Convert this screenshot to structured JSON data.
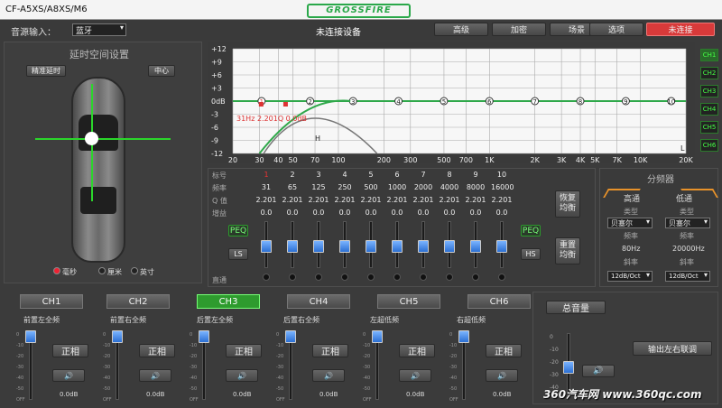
{
  "window": {
    "title": "CF-A5XS/A8XS/M6"
  },
  "toolbar": {
    "source_label": "音源输入：",
    "source_value": "蓝牙",
    "status": "未连接设备",
    "buttons": [
      "高级",
      "加密",
      "场景",
      "选项"
    ],
    "connect_label": "未连接",
    "logo": "GROSSFIRE"
  },
  "delay": {
    "title": "延时空间设置",
    "precise_label": "精准延时",
    "center_label": "中心",
    "units": [
      "毫秒",
      "厘米",
      "英寸"
    ]
  },
  "eq_graph": {
    "y_ticks": [
      "+12",
      "+9",
      "+6",
      "+3",
      "0dB",
      "-3",
      "-6",
      "-9",
      "-12"
    ],
    "x_ticks": [
      "20",
      "30",
      "40",
      "50",
      "70",
      "100",
      "200",
      "300",
      "500",
      "700",
      "1K",
      "2K",
      "3K",
      "4K",
      "5K",
      "7K",
      "10K",
      "20K"
    ],
    "band_markers": [
      "1",
      "2",
      "3",
      "4",
      "5",
      "6",
      "7",
      "8",
      "9",
      "10"
    ],
    "readout": "31Hz 2.201Q 0.0dB",
    "marker_h": "H",
    "marker_l": "L",
    "channels": [
      "CH1",
      "CH2",
      "CH3",
      "CH4",
      "CH5",
      "CH6"
    ]
  },
  "eq_table": {
    "row_labels": [
      "标号",
      "频率",
      "Q 值",
      "增益"
    ],
    "bands": [
      "1",
      "2",
      "3",
      "4",
      "5",
      "6",
      "7",
      "8",
      "9",
      "10"
    ],
    "freqs": [
      "31",
      "65",
      "125",
      "250",
      "500",
      "1000",
      "2000",
      "4000",
      "8000",
      "16000"
    ],
    "q": [
      "2.201",
      "2.201",
      "2.201",
      "2.201",
      "2.201",
      "2.201",
      "2.201",
      "2.201",
      "2.201",
      "2.201"
    ],
    "gains": [
      "0.0",
      "0.0",
      "0.0",
      "0.0",
      "0.0",
      "0.0",
      "0.0",
      "0.0",
      "0.0",
      "0.0"
    ],
    "bypass_label": "直通",
    "peq_left": "PEQ",
    "ls_label": "LS",
    "peq_right": "PEQ",
    "hs_label": "HS",
    "restore_label": "恢复均衡",
    "reset_label": "重置均衡"
  },
  "crossover": {
    "title": "分频器",
    "hp_title": "高通",
    "lp_title": "低通",
    "type_label": "类型",
    "hp_type": "贝塞尔",
    "lp_type": "贝塞尔",
    "freq_label": "频率",
    "hp_freq": "80Hz",
    "lp_freq": "20000Hz",
    "slope_label": "斜率",
    "hp_slope": "12dB/Oct",
    "lp_slope": "12dB/Oct"
  },
  "channels": [
    {
      "name": "CH1",
      "label": "前置左全频",
      "phase": "正相",
      "level": "0.0dB"
    },
    {
      "name": "CH2",
      "label": "前置右全频",
      "phase": "正相",
      "level": "0.0dB"
    },
    {
      "name": "CH3",
      "label": "后置左全频",
      "phase": "正相",
      "level": "0.0dB"
    },
    {
      "name": "CH4",
      "label": "后置右全频",
      "phase": "正相",
      "level": "0.0dB"
    },
    {
      "name": "CH5",
      "label": "左超低频",
      "phase": "正相",
      "level": "0.0dB"
    },
    {
      "name": "CH6",
      "label": "右超低频",
      "phase": "正相",
      "level": "0.0dB"
    }
  ],
  "fader_ticks": [
    "0",
    "-10",
    "-20",
    "-30",
    "-40",
    "-50",
    "OFF"
  ],
  "master": {
    "title": "总音量",
    "link_label": "输出左右联调",
    "ticks": [
      "0",
      "-10",
      "-20",
      "-30",
      "-40"
    ]
  },
  "watermark": {
    "text": "360汽车网 www.360qc.com"
  },
  "colors": {
    "accent_green": "#2e9b2e",
    "connect_red": "#d83a3a",
    "knob_blue": "#3b82e6"
  }
}
